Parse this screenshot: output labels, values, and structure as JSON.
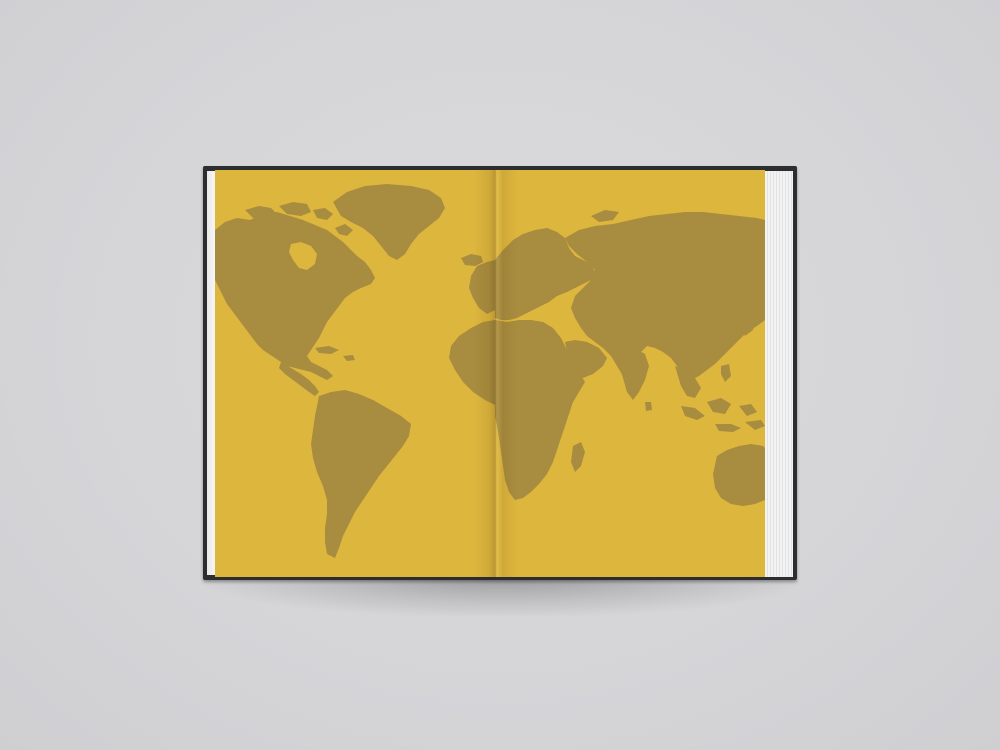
{
  "scene": {
    "subject": "open-hardcover-book",
    "colors": {
      "background": "#d7d7d9",
      "cover": "#2b2d2f",
      "page": "#ddb63e",
      "land": "#a88c3f",
      "page_edge": "#f3f3f3"
    }
  },
  "book": {
    "left_page_content": "world-map-americas",
    "right_page_content": "world-map-europe-africa-asia-australia"
  }
}
